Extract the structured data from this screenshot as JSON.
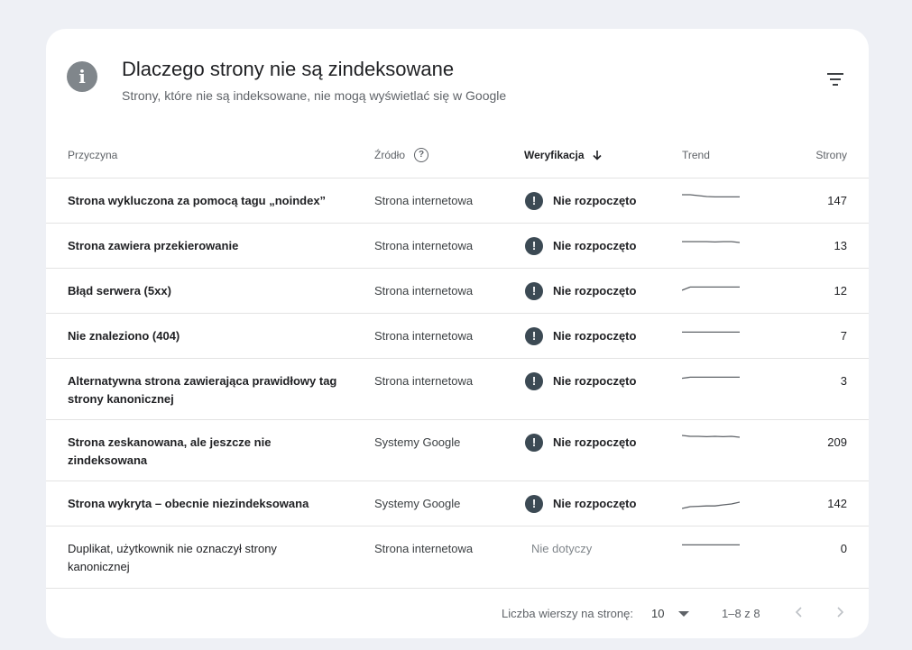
{
  "header": {
    "title": "Dlaczego strony nie są zindeksowane",
    "subtitle": "Strony, które nie są indeksowane, nie mogą wyświetlać się w Google"
  },
  "columns": {
    "reason": "Przyczyna",
    "source": "Źródło",
    "verification": "Weryfikacja",
    "trend": "Trend",
    "pages": "Strony"
  },
  "rows": [
    {
      "reason": "Strona wykluczona za pomocą tagu „noindex”",
      "source": "Strona internetowa",
      "status": "Nie rozpoczęto",
      "pages": "147",
      "trend": [
        0.9,
        0.9,
        0.85,
        0.8,
        0.78,
        0.78,
        0.78,
        0.78
      ]
    },
    {
      "reason": "Strona zawiera przekierowanie",
      "source": "Strona internetowa",
      "status": "Nie rozpoczęto",
      "pages": "13",
      "trend": [
        0.8,
        0.8,
        0.8,
        0.8,
        0.78,
        0.8,
        0.8,
        0.75
      ]
    },
    {
      "reason": "Błąd serwera (5xx)",
      "source": "Strona internetowa",
      "status": "Nie rozpoczęto",
      "pages": "12",
      "trend": [
        0.6,
        0.78,
        0.78,
        0.78,
        0.78,
        0.78,
        0.78,
        0.78
      ]
    },
    {
      "reason": "Nie znaleziono (404)",
      "source": "Strona internetowa",
      "status": "Nie rozpoczęto",
      "pages": "7",
      "trend": [
        0.78,
        0.78,
        0.78,
        0.78,
        0.78,
        0.78,
        0.78,
        0.78
      ]
    },
    {
      "reason": "Alternatywna strona zawierająca prawidłowy tag strony kanonicznej",
      "source": "Strona internetowa",
      "status": "Nie rozpoczęto",
      "pages": "3",
      "trend": [
        0.72,
        0.78,
        0.78,
        0.78,
        0.78,
        0.78,
        0.78,
        0.78
      ]
    },
    {
      "reason": "Strona zeskanowana, ale jeszcze nie zindeksowana",
      "source": "Systemy Google",
      "status": "Nie rozpoczęto",
      "pages": "209",
      "trend": [
        0.95,
        0.9,
        0.9,
        0.88,
        0.9,
        0.88,
        0.9,
        0.85
      ]
    },
    {
      "reason": "Strona wykryta – obecnie niezindeksowana",
      "source": "Systemy Google",
      "status": "Nie rozpoczęto",
      "pages": "142",
      "trend": [
        0.3,
        0.4,
        0.42,
        0.44,
        0.44,
        0.5,
        0.55,
        0.65
      ]
    },
    {
      "reason": "Duplikat, użytkownik nie oznaczył strony kanonicznej",
      "source": "Strona internetowa",
      "status": "Nie dotyczy",
      "pages": "0",
      "trend": [
        0.78,
        0.78,
        0.78,
        0.78,
        0.78,
        0.78,
        0.78,
        0.78
      ]
    }
  ],
  "footer": {
    "rows_per_page_label": "Liczba wierszy na stronę:",
    "rows_per_page_value": "10",
    "range": "1–8 z 8"
  },
  "icons": {
    "header": "info-icon",
    "filter": "filter-icon",
    "help": "help-circle-icon",
    "sort": "arrow-down-icon",
    "status": "exclamation-circle-icon",
    "prev": "chevron-left-icon",
    "next": "chevron-right-icon"
  },
  "colors": {
    "background": "#eef0f5",
    "card": "#ffffff",
    "status_icon": "#3c4a54",
    "info_icon": "#80868b"
  }
}
